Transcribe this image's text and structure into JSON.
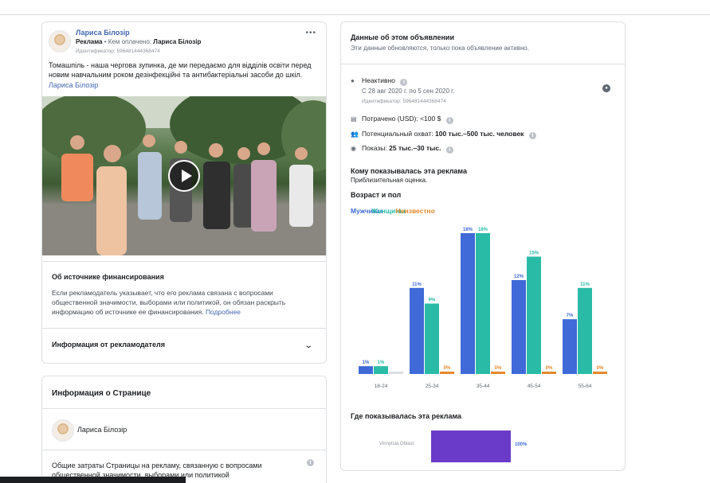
{
  "post": {
    "author": "Лариса Білозір",
    "sponsored_label": "Реклама",
    "paid_by_prefix": "• Кем оплачено:",
    "paid_by": "Лариса Білозір",
    "id_text": "Идентификатор: 596481444368474",
    "more": "•••",
    "text": "Томашпіль - наша чергова зупинка, де ми передаємо для відділів освіти перед новим навчальним роком дезінфекційні та антибактеріальні засоби до шкіл.",
    "tag": "Лариса Білозір"
  },
  "funding": {
    "title": "Об источнике финансирования",
    "text": "Если рекламодатель указывает, что его реклама связана с вопросами общественной значимости, выборами или политикой, он обязан раскрыть информацию об источнике ее финансирования.",
    "link": "Подробнее"
  },
  "advertiser": {
    "title": "Информация от рекламодателя"
  },
  "page_info": {
    "title": "Информация о Странице",
    "name": "Лариса Білозір",
    "spend_text": "Общие затраты Страницы на рекламу, связанную с вопросами общественной значимости, выборами или политикой"
  },
  "ad_data": {
    "title": "Данные об этом объявлении",
    "subtitle": "Эти данные обновляются, только пока объявление активно.",
    "status": "Неактивно",
    "dates": "С 28 авг 2020 г. по 5 сен 2020 г.",
    "id_text": "Идентификатор: 596481444368474",
    "spent": "Потрачено (USD): <100 $",
    "reach_label": "Потенциальный охват:",
    "reach_value": "100 тыс.–500 тыс. человек",
    "impressions_label": "Показы:",
    "impressions_value": "25 тыс.–30 тыс.",
    "audience_title": "Кому показывалась эта реклама",
    "audience_sub": "Приблизительная оценка.",
    "age_gender_title": "Возраст и пол",
    "legend": [
      "Мужчины",
      "Женщины",
      "Неизвестно"
    ],
    "where_title": "Где показывалась эта реклама",
    "region": "Vinnytsia Oblast",
    "region_value": "100%"
  },
  "colors": {
    "male": "#3f6ad8",
    "female": "#2abba7",
    "unknown": "#e4882d",
    "region": "#6a3bc9",
    "link": "#4267b2"
  },
  "icons": [
    "info-icon",
    "globe-icon",
    "money-icon",
    "people-icon",
    "eye-icon",
    "chevron-down-icon",
    "play-icon"
  ],
  "chart_data": {
    "type": "bar",
    "categories": [
      "18-24",
      "25-34",
      "35-44",
      "45-54",
      "55-64"
    ],
    "series": [
      {
        "name": "Мужчины",
        "values": [
          1,
          11,
          18,
          12,
          7
        ],
        "labels": [
          "1%",
          "11%",
          "18%",
          "12%",
          "7%"
        ]
      },
      {
        "name": "Женщины",
        "values": [
          1,
          9,
          18,
          15,
          11
        ],
        "labels": [
          "1%",
          "9%",
          "18%",
          "15%",
          "11%"
        ]
      },
      {
        "name": "Неизвестно",
        "values": [
          0,
          0,
          0,
          0,
          0
        ],
        "labels": [
          "",
          "0%",
          "0%",
          "0%",
          "0%"
        ]
      }
    ],
    "ylim": [
      0,
      18
    ]
  }
}
